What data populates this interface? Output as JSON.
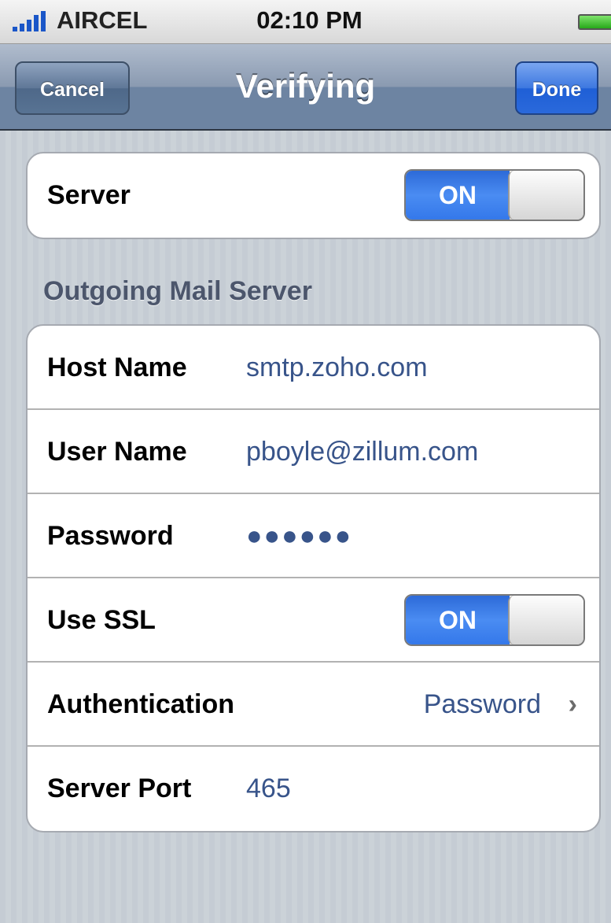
{
  "status_bar": {
    "carrier": "AIRCEL",
    "time": "02:10 PM",
    "signal_icon": "signal-bars-icon",
    "battery_icon": "battery-icon"
  },
  "nav": {
    "cancel_label": "Cancel",
    "title": "Verifying",
    "done_label": "Done"
  },
  "server_group": {
    "label": "Server",
    "toggle_label": "ON"
  },
  "outgoing": {
    "header": "Outgoing Mail Server",
    "host_label": "Host Name",
    "host_value": "smtp.zoho.com",
    "user_label": "User Name",
    "user_value": "pboyle@zillum.com",
    "password_label": "Password",
    "password_value": "●●●●●●",
    "ssl_label": "Use SSL",
    "ssl_toggle": "ON",
    "auth_label": "Authentication",
    "auth_value": "Password",
    "port_label": "Server Port",
    "port_value": "465"
  },
  "colors": {
    "value_text": "#38548a",
    "toggle_on": "#3478ea",
    "nav_bar": "#6d84a2"
  }
}
